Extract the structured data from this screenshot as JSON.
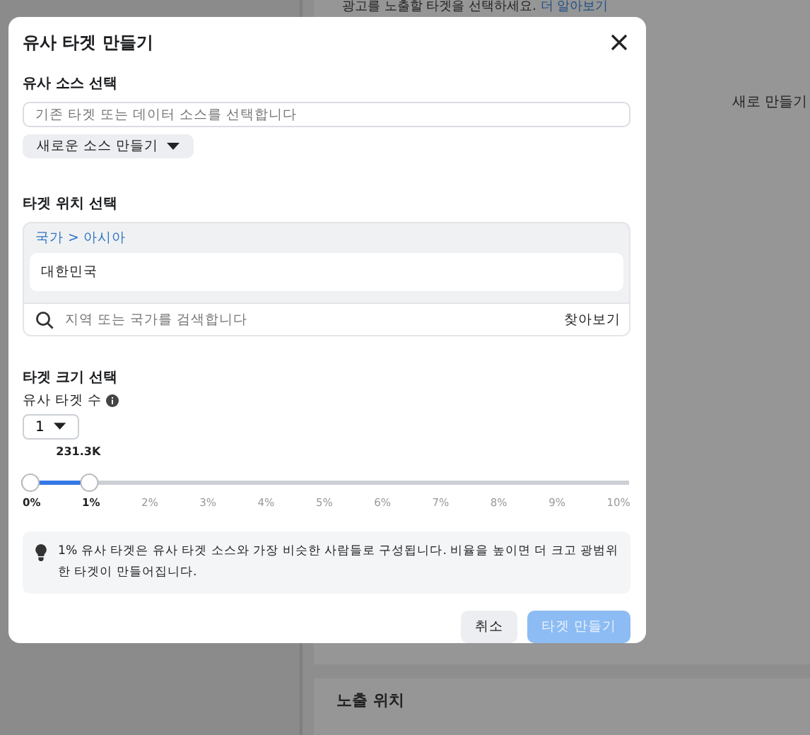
{
  "background": {
    "intro": "광고를 노출할 타겟을 선택하세요.",
    "intro_link": "더 알아보기",
    "new_button": "새로 만들기",
    "placement_title": "노출 위치"
  },
  "dialog": {
    "title": "유사 타겟 만들기",
    "source": {
      "label": "유사 소스 선택",
      "placeholder": "기존 타겟 또는 데이터 소스를 선택합니다",
      "create_button": "새로운 소스 만들기"
    },
    "location": {
      "label": "타겟 위치 선택",
      "breadcrumb": "국가 > 아시아",
      "selected_item": "대한민국",
      "search_placeholder": "지역 또는 국가를 검색합니다",
      "browse": "찾아보기"
    },
    "size": {
      "label": "타겟 크기 선택",
      "count_label": "유사 타겟 수",
      "count_value": "1",
      "estimate": "231.3K",
      "level": 0.1,
      "ticks": [
        {
          "label": "0%",
          "active": true
        },
        {
          "label": "1%",
          "active": true
        },
        {
          "label": "2%",
          "active": false
        },
        {
          "label": "3%",
          "active": false
        },
        {
          "label": "4%",
          "active": false
        },
        {
          "label": "5%",
          "active": false
        },
        {
          "label": "6%",
          "active": false
        },
        {
          "label": "7%",
          "active": false
        },
        {
          "label": "8%",
          "active": false
        },
        {
          "label": "9%",
          "active": false
        },
        {
          "label": "10%",
          "active": false
        }
      ]
    },
    "tip": "1% 유사 타겟은 유사 타겟 소스와 가장 비슷한 사람들로 구성됩니다. 비율을 높이면 더 크고 광범위한 타겟이 만들어집니다.",
    "buttons": [
      {
        "label": "취소",
        "kind": "secondary",
        "disabled": false
      },
      {
        "label": "타겟 만들기",
        "kind": "primary",
        "disabled": true
      }
    ]
  }
}
